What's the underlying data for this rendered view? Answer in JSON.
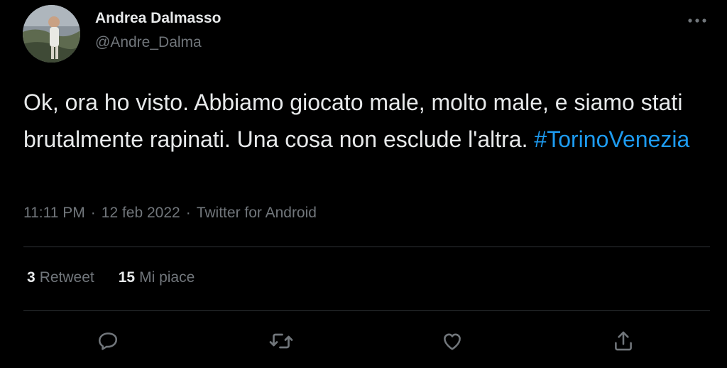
{
  "author": {
    "name": "Andrea Dalmasso",
    "handle": "@Andre_Dalma"
  },
  "tweet": {
    "text_main": "Ok, ora ho visto. Abbiamo giocato male, molto male, e siamo stati brutalmente rapinati. Una cosa non esclude l'altra.",
    "hashtag": "#TorinoVenezia",
    "time": "11:11 PM",
    "date": "12 feb 2022",
    "separator": "·",
    "source": "Twitter for Android"
  },
  "stats": {
    "retweets_count": "3",
    "retweets_label": "Retweet",
    "likes_count": "15",
    "likes_label": "Mi piace"
  },
  "icons": {
    "more": "more-horizontal-icon",
    "reply": "reply-icon",
    "retweet": "retweet-icon",
    "like": "heart-icon",
    "share": "share-icon"
  },
  "colors": {
    "background": "#000000",
    "text": "#e7e9ea",
    "secondary": "#71767b",
    "link": "#1d9bf0",
    "divider": "#2f3336"
  }
}
